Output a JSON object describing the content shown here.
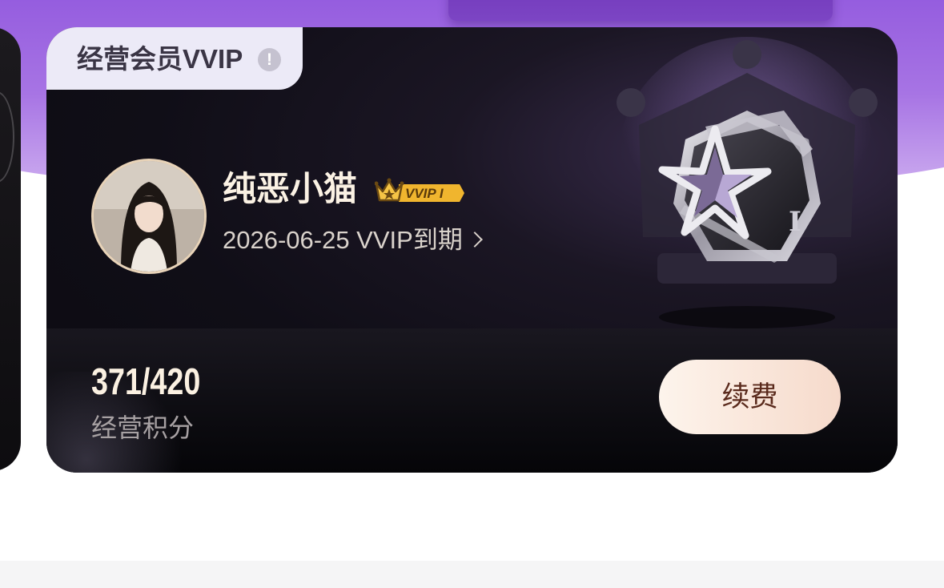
{
  "card": {
    "tag_title": "经营会员VVIP",
    "tag_info_glyph": "!",
    "user": {
      "name": "纯恶小猫",
      "badge_text": "VVIP I",
      "expire_text": "2026-06-25 VVIP到期"
    },
    "medal_level": "I",
    "score": {
      "value": "371/420",
      "label": "经营积分"
    },
    "renew_label": "续费"
  },
  "icons": {
    "info": "info-icon",
    "crown": "crown-icon",
    "chevron": "chevron-right-icon",
    "medal": "star-medal-icon"
  },
  "colors": {
    "purple_bg": "#9a62e0",
    "card_bg": "#0f0d14",
    "gold": "#f0b52e",
    "renew_btn": "#fbe7dc"
  }
}
